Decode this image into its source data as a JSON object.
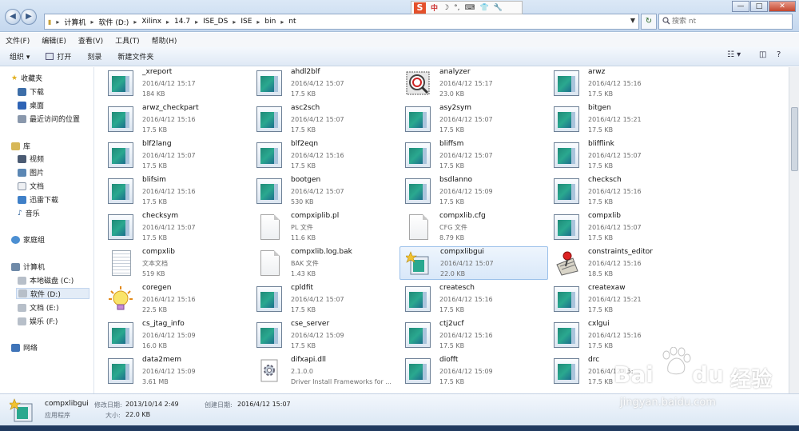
{
  "window": {
    "breadcrumbs": [
      "计算机",
      "软件 (D:)",
      "Xilinx",
      "14.7",
      "ISE_DS",
      "ISE",
      "bin",
      "nt"
    ],
    "search_placeholder": "搜索 nt",
    "min_label": "—",
    "max_label": "□",
    "close_label": "✕"
  },
  "ime": {
    "logo": "S",
    "mode": "中",
    "items": [
      "☽",
      "°,",
      "⌨",
      "👕",
      "🔧"
    ]
  },
  "menu": [
    "文件(F)",
    "编辑(E)",
    "查看(V)",
    "工具(T)",
    "帮助(H)"
  ],
  "toolbar": {
    "organize": "组织 ▾",
    "open": "打开",
    "burn": "刻录",
    "new_folder": "新建文件夹"
  },
  "sidebar": {
    "favorites": {
      "label": "收藏夹",
      "items": [
        "下载",
        "桌面",
        "最近访问的位置"
      ]
    },
    "libraries": {
      "label": "库",
      "items": [
        "视频",
        "图片",
        "文档",
        "迅雷下载",
        "音乐"
      ]
    },
    "homegroup": "家庭组",
    "computer": {
      "label": "计算机",
      "items": [
        "本地磁盘 (C:)",
        "软件 (D:)",
        "文档 (E:)",
        "娱乐 (F:)"
      ]
    },
    "network": "网络"
  },
  "files": [
    {
      "name": "_xreport",
      "l1": "2016/4/12 15:17",
      "l2": "184 KB",
      "icon": "exe-icon"
    },
    {
      "name": "ahdl2blf",
      "l1": "2016/4/12 15:07",
      "l2": "17.5 KB",
      "icon": "exe-icon"
    },
    {
      "name": "analyzer",
      "l1": "2016/4/12 15:17",
      "l2": "23.0 KB",
      "icon": "analyzer-icon"
    },
    {
      "name": "arwz",
      "l1": "2016/4/12 15:16",
      "l2": "17.5 KB",
      "icon": "exe-icon"
    },
    {
      "name": "arwz_checkpart",
      "l1": "2016/4/12 15:16",
      "l2": "17.5 KB",
      "icon": "exe-icon"
    },
    {
      "name": "asc2sch",
      "l1": "2016/4/12 15:07",
      "l2": "17.5 KB",
      "icon": "exe-icon"
    },
    {
      "name": "asy2sym",
      "l1": "2016/4/12 15:07",
      "l2": "17.5 KB",
      "icon": "exe-icon"
    },
    {
      "name": "bitgen",
      "l1": "2016/4/12 15:21",
      "l2": "17.5 KB",
      "icon": "exe-icon"
    },
    {
      "name": "blf2lang",
      "l1": "2016/4/12 15:07",
      "l2": "17.5 KB",
      "icon": "exe-icon"
    },
    {
      "name": "blf2eqn",
      "l1": "2016/4/12 15:16",
      "l2": "17.5 KB",
      "icon": "exe-icon"
    },
    {
      "name": "bliffsm",
      "l1": "2016/4/12 15:07",
      "l2": "17.5 KB",
      "icon": "exe-icon"
    },
    {
      "name": "blifflink",
      "l1": "2016/4/12 15:07",
      "l2": "17.5 KB",
      "icon": "exe-icon"
    },
    {
      "name": "blifsim",
      "l1": "2016/4/12 15:16",
      "l2": "17.5 KB",
      "icon": "exe-icon"
    },
    {
      "name": "bootgen",
      "l1": "2016/4/12 15:07",
      "l2": "530 KB",
      "icon": "exe-icon"
    },
    {
      "name": "bsdlanno",
      "l1": "2016/4/12 15:09",
      "l2": "17.5 KB",
      "icon": "exe-icon"
    },
    {
      "name": "checksch",
      "l1": "2016/4/12 15:16",
      "l2": "17.5 KB",
      "icon": "exe-icon"
    },
    {
      "name": "checksym",
      "l1": "2016/4/12 15:07",
      "l2": "17.5 KB",
      "icon": "exe-icon"
    },
    {
      "name": "compxiplib.pl",
      "l1": "PL 文件",
      "l2": "11.6 KB",
      "icon": "document-icon"
    },
    {
      "name": "compxlib.cfg",
      "l1": "CFG 文件",
      "l2": "8.79 KB",
      "icon": "document-icon"
    },
    {
      "name": "compxlib",
      "l1": "2016/4/12 15:07",
      "l2": "17.5 KB",
      "icon": "exe-icon"
    },
    {
      "name": "compxlib",
      "l1": "文本文档",
      "l2": "519 KB",
      "icon": "text-file-icon"
    },
    {
      "name": "compxlib.log.bak",
      "l1": "BAK 文件",
      "l2": "1.43 KB",
      "icon": "document-icon"
    },
    {
      "name": "compxlibgui",
      "l1": "2016/4/12 15:07",
      "l2": "22.0 KB",
      "icon": "compxlibgui-icon"
    },
    {
      "name": "constraints_editor",
      "l1": "2016/4/12 15:16",
      "l2": "18.5 KB",
      "icon": "constraints-editor-icon"
    },
    {
      "name": "coregen",
      "l1": "2016/4/12 15:16",
      "l2": "22.5 KB",
      "icon": "coregen-lightbulb-icon"
    },
    {
      "name": "cpldfit",
      "l1": "2016/4/12 15:07",
      "l2": "17.5 KB",
      "icon": "exe-icon"
    },
    {
      "name": "createsch",
      "l1": "2016/4/12 15:16",
      "l2": "17.5 KB",
      "icon": "exe-icon"
    },
    {
      "name": "createxaw",
      "l1": "2016/4/12 15:21",
      "l2": "17.5 KB",
      "icon": "exe-icon"
    },
    {
      "name": "cs_jtag_info",
      "l1": "2016/4/12 15:09",
      "l2": "16.0 KB",
      "icon": "exe-icon"
    },
    {
      "name": "cse_server",
      "l1": "2016/4/12 15:09",
      "l2": "17.5 KB",
      "icon": "exe-icon"
    },
    {
      "name": "ctj2ucf",
      "l1": "2016/4/12 15:16",
      "l2": "17.5 KB",
      "icon": "exe-icon"
    },
    {
      "name": "cxlgui",
      "l1": "2016/4/12 15:16",
      "l2": "17.5 KB",
      "icon": "exe-icon"
    },
    {
      "name": "data2mem",
      "l1": "2016/4/12 15:09",
      "l2": "3.61 MB",
      "icon": "exe-icon"
    },
    {
      "name": "difxapi.dll",
      "l1": "2.1.0.0",
      "l2": "Driver Install Frameworks for ...",
      "icon": "dll-icon"
    },
    {
      "name": "diofft",
      "l1": "2016/4/12 15:09",
      "l2": "17.5 KB",
      "icon": "exe-icon"
    },
    {
      "name": "drc",
      "l1": "2016/4/12 15:",
      "l2": "17.5 KB",
      "icon": "exe-icon"
    }
  ],
  "details": {
    "name": "compxlibgui",
    "type": "应用程序",
    "modified_label": "修改日期:",
    "modified": "2013/10/14 2:49",
    "created_label": "创建日期:",
    "created": "2016/4/12 15:07",
    "size_label": "大小:",
    "size": "22.0 KB"
  },
  "watermark": {
    "brand": "Bai",
    "brand2": "du",
    "cn": "经验",
    "url": "jingyan.baidu.com"
  }
}
